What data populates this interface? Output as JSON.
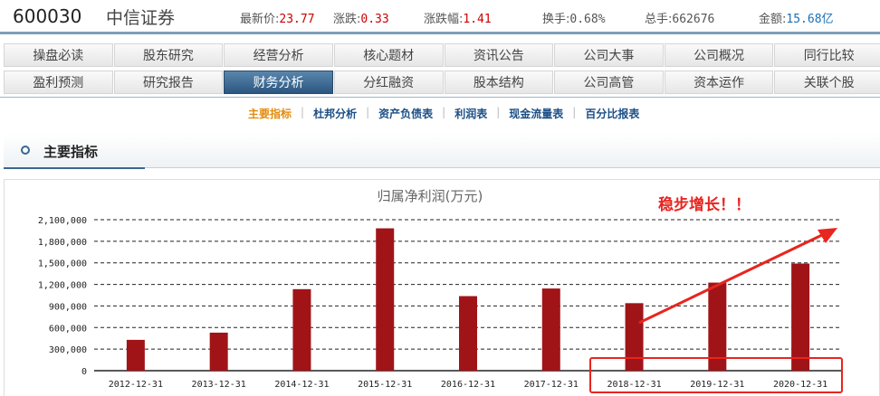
{
  "header": {
    "code": "600030",
    "name": "中信证券",
    "quotes": [
      {
        "label": "最新价:",
        "value": "23.77",
        "color": "red"
      },
      {
        "label": "涨跌:",
        "value": "0.33",
        "color": "red"
      },
      {
        "label": "涨跌幅:",
        "value": "1.41",
        "color": "red"
      },
      {
        "label": "换手:",
        "value": "0.68%",
        "color": ""
      },
      {
        "label": "总手:",
        "value": "662676",
        "color": ""
      },
      {
        "label": "金额:",
        "value": "15.68亿",
        "color": "blue"
      }
    ]
  },
  "tabs_row1": [
    "操盘必读",
    "股东研究",
    "经营分析",
    "核心题材",
    "资讯公告",
    "公司大事",
    "公司概况",
    "同行比较"
  ],
  "tabs_row2": [
    "盈利预测",
    "研究报告",
    "财务分析",
    "分红融资",
    "股本结构",
    "公司高管",
    "资本运作",
    "关联个股"
  ],
  "active_tab": "财务分析",
  "subnav": [
    "主要指标",
    "杜邦分析",
    "资产负债表",
    "利润表",
    "现金流量表",
    "百分比报表"
  ],
  "active_subnav": "主要指标",
  "section_title": "主要指标",
  "chart_data": {
    "type": "bar",
    "title": "归属净利润(万元)",
    "categories": [
      "2012-12-31",
      "2013-12-31",
      "2014-12-31",
      "2015-12-31",
      "2016-12-31",
      "2017-12-31",
      "2018-12-31",
      "2019-12-31",
      "2020-12-31"
    ],
    "values": [
      429000,
      529000,
      1134000,
      1980000,
      1037000,
      1143000,
      939000,
      1225000,
      1490000
    ],
    "ylim": [
      0,
      2100000
    ],
    "yticks": [
      0,
      300000,
      600000,
      900000,
      1200000,
      1500000,
      1800000,
      2100000
    ],
    "ytick_labels": [
      "0",
      "300,000",
      "600,000",
      "900,000",
      "1,200,000",
      "1,500,000",
      "1,800,000",
      "2,100,000"
    ],
    "grid": true,
    "bar_color": "#a01418",
    "annotation": "稳步增长！！",
    "highlight_categories": [
      "2018-12-31",
      "2019-12-31",
      "2020-12-31"
    ],
    "annotation_color": "#e8251f"
  }
}
